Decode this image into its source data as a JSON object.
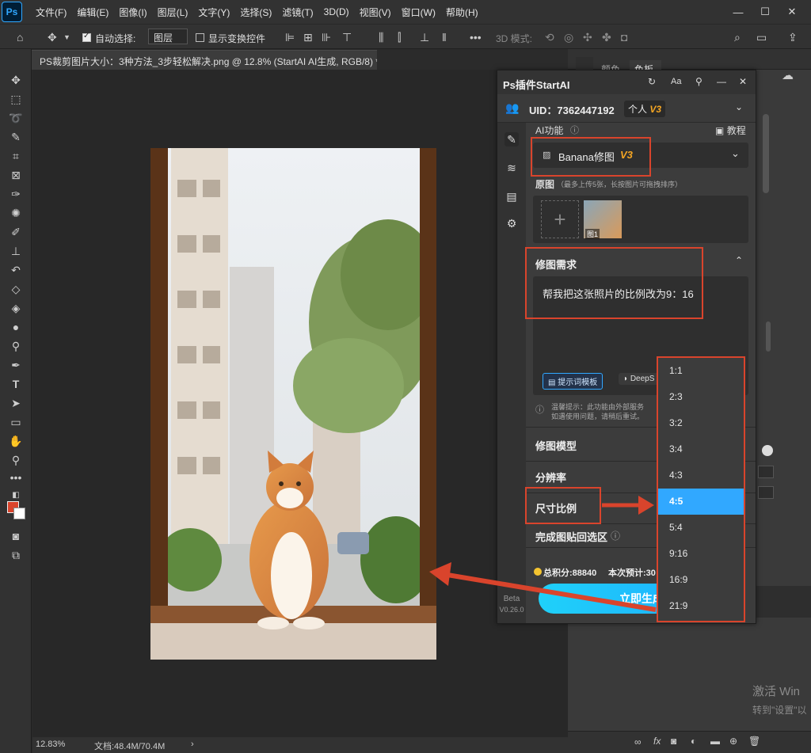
{
  "app": {
    "logo": "Ps"
  },
  "menu": [
    "文件(F)",
    "编辑(E)",
    "图像(I)",
    "图层(L)",
    "文字(Y)",
    "选择(S)",
    "滤镜(T)",
    "3D(D)",
    "视图(V)",
    "窗口(W)",
    "帮助(H)"
  ],
  "options": {
    "auto_select_label": "自动选择:",
    "auto_select_value": "图层",
    "show_transform_label": "显示变换控件",
    "mode_3d_label": "3D 模式:"
  },
  "document": {
    "tab_title": "PS裁剪图片大小：3种方法_3步轻松解决.png @ 12.8% (StartAI AI生成, RGB/8) *",
    "zoom": "12.83%",
    "doc_info": "文档:48.4M/70.4M"
  },
  "right_dock": {
    "tab_color": "颜色",
    "tab_swatches": "色板"
  },
  "plugin": {
    "title": "Ps插件StartAI",
    "uid": "UID：7362447192",
    "plan": "个人",
    "plan_version": "V3",
    "ai_function_label": "AI功能",
    "tutorial_label": "教程",
    "function_value": "Banana修图",
    "function_version": "V3",
    "source_label": "原图",
    "source_hint": "（最多上传5张，长按图片可拖拽排序）",
    "thumb_label": "图1",
    "request_label": "修图需求",
    "request_text": "帮我把这张照片的比例改为9：16",
    "prompt_template_btn": "提示词模板",
    "deepseek_btn": "DeepS",
    "notice_line1": "温馨提示：此功能由外部服务",
    "notice_line2": "如遇使用问题，请稍后重试。",
    "model_label": "修图模型",
    "resolution_label": "分辨率",
    "ratio_label": "尺寸比例",
    "paste_back_label": "完成图贴回选区",
    "points": "总积分:88840",
    "estimate": "本次预计:30",
    "generate_btn": "立即生成",
    "beta": "Beta",
    "version": "V0.26.0"
  },
  "ratio_options": [
    "1:1",
    "2:3",
    "3:2",
    "3:4",
    "4:3",
    "4:5",
    "5:4",
    "9:16",
    "16:9",
    "21:9"
  ],
  "ratio_selected": "4:5",
  "watermark": {
    "line1": "激活 Win",
    "line2": "转到\"设置\"以"
  },
  "colors": {
    "accent": "#31a8ff",
    "annotation_red": "#d9442c",
    "generate_gradient_start": "#1fd1f9",
    "generate_gradient_end": "#1ea8ff",
    "points_coin": "#f4c430",
    "version_tag": "#f5a623"
  }
}
